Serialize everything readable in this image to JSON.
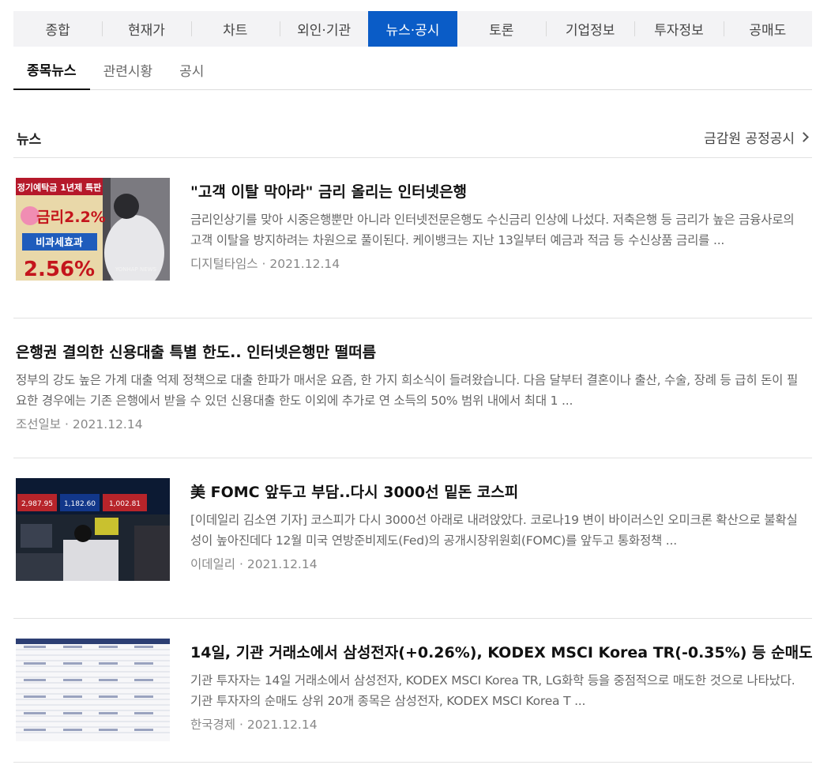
{
  "tabs": [
    {
      "label": "종합",
      "active": false
    },
    {
      "label": "현재가",
      "active": false
    },
    {
      "label": "차트",
      "active": false
    },
    {
      "label": "외인·기관",
      "active": false
    },
    {
      "label": "뉴스·공시",
      "active": true
    },
    {
      "label": "토론",
      "active": false
    },
    {
      "label": "기업정보",
      "active": false
    },
    {
      "label": "투자정보",
      "active": false
    },
    {
      "label": "공매도",
      "active": false
    }
  ],
  "subtabs": [
    {
      "label": "종목뉴스",
      "active": true
    },
    {
      "label": "관련시황",
      "active": false
    },
    {
      "label": "공시",
      "active": false
    }
  ],
  "section": {
    "title": "뉴스",
    "link_label": "금감원 공정공시"
  },
  "news": [
    {
      "title": "\"고객 이탈 막아라\" 금리 올리는 인터넷은행",
      "summary": "금리인상기를 맞아 시중은행뿐만 아니라 인터넷전문은행도 수신금리 인상에 나섰다. 저축은행 등 금리가 높은 금융사로의 고객 이탈을 방지하려는 차원으로 풀이된다. 케이뱅크는 지난 13일부터 예금과 적금 등 수신상품 금리를 ...",
      "source": "디지털타임스",
      "date": "2021.12.14",
      "thumb": {
        "sign_top": "정기예탁금 1년제 특판",
        "sign_mid": "금리2.2%",
        "sign_low": "비과세효과",
        "sign_big": "2.56%",
        "watermark": "YONHAP NEWS"
      }
    },
    {
      "title": "은행권 결의한 신용대출 특별 한도.. 인터넷은행만 떨떠름",
      "summary": "정부의 강도 높은 가계 대출 억제 정책으로 대출 한파가 매서운 요즘, 한 가지 희소식이 들려왔습니다. 다음 달부터 결혼이나 출산, 수술, 장례 등 급히 돈이 필요한 경우에는 기존 은행에서 받을 수 있던 신용대출 한도 이외에 추가로 연 소득의 50% 범위 내에서 최대 1 ...",
      "source": "조선일보",
      "date": "2021.12.14"
    },
    {
      "title": "美 FOMC 앞두고 부담..다시 3000선 밑돈 코스피",
      "summary": "[이데일리 김소연 기자] 코스피가 다시 3000선 아래로 내려앉았다. 코로나19 변이 바이러스인 오미크론 확산으로 불확실성이 높아진데다 12월 미국 연방준비제도(Fed)의 공개시장위원회(FOMC)를 앞두고 통화정책 ...",
      "source": "이데일리",
      "date": "2021.12.14",
      "thumb": {
        "board1": "2,987.95",
        "board2": "1,182.60",
        "board3": "1,002.81"
      }
    },
    {
      "title": "14일, 기관 거래소에서 삼성전자(+0.26%), KODEX MSCI Korea TR(-0.35%) 등 순매도",
      "summary": "기관 투자자는 14일 거래소에서 삼성전자, KODEX MSCI Korea TR, LG화학 등을 중점적으로 매도한 것으로 나타났다. 기관 투자자의 순매도 상위 20개 종목은 삼성전자, KODEX MSCI Korea T ...",
      "source": "한국경제",
      "date": "2021.12.14"
    }
  ],
  "meta_separator": " · ",
  "colors": {
    "accent": "#0a5cc7",
    "text": "#111111",
    "muted": "#666666",
    "meta": "#888888"
  }
}
